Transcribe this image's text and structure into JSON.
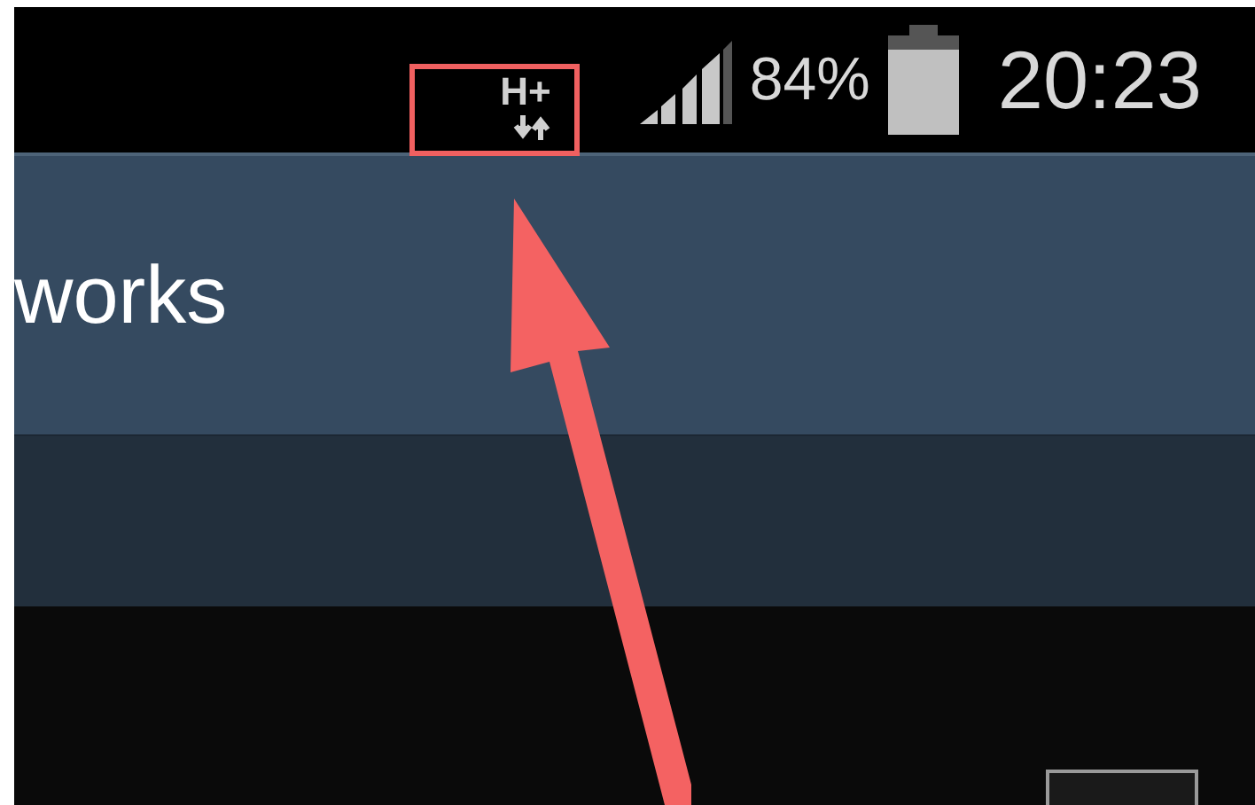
{
  "status_bar": {
    "network_type": "H+",
    "battery": "84%",
    "time": "20:23"
  },
  "action_bar": {
    "title": "works"
  }
}
